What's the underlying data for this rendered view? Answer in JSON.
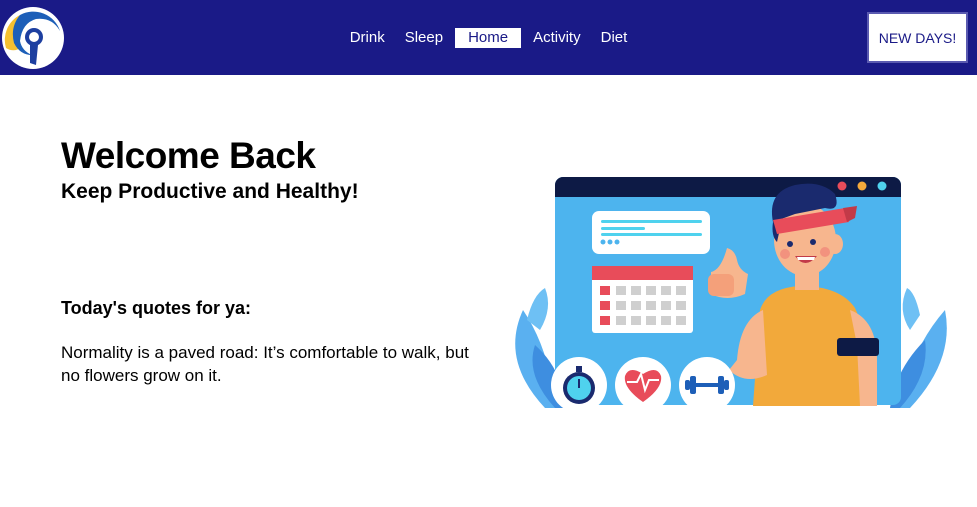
{
  "nav": {
    "links": [
      {
        "label": "Drink"
      },
      {
        "label": "Sleep"
      },
      {
        "label": "Home"
      },
      {
        "label": "Activity"
      },
      {
        "label": "Diet"
      }
    ],
    "active_index": 2,
    "action_label": "NEW DAYS!"
  },
  "hero": {
    "title": "Welcome Back",
    "subtitle": "Keep Productive and Healthy!"
  },
  "quote": {
    "label": "Today's quotes for ya:",
    "text": "Normality is a paved road: It’s comfortable to walk, but no flowers grow on it."
  },
  "illustration": {
    "icons": [
      "stopwatch-icon",
      "heart-rate-icon",
      "dumbbell-icon"
    ]
  },
  "colors": {
    "navbar": "#1a1a87",
    "accent_blue": "#4a9be8",
    "calendar_red": "#e84c5a",
    "shirt": "#f2a93b"
  }
}
